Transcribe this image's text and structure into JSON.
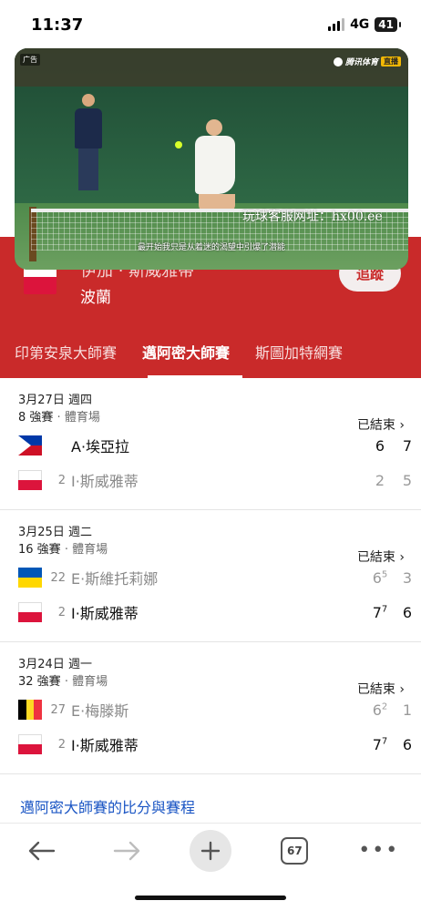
{
  "status_bar": {
    "time": "11:37",
    "network": "4G",
    "battery": "41"
  },
  "player_header": {
    "name": "伊加 · 斯威雅蒂",
    "country": "波蘭",
    "follow_label": "追蹤"
  },
  "video": {
    "ad_label": "广告",
    "brand": "腾讯体育",
    "live_label": "直播",
    "subtitle": "最开始我只是从着迷的渴望中引爆了潜能",
    "watermark": "玩球客服网址：hx00.ee"
  },
  "tabs": [
    {
      "label": "印第安泉大師賽",
      "active": false
    },
    {
      "label": "邁阿密大師賽",
      "active": true
    },
    {
      "label": "斯圖加特網賽",
      "active": false
    }
  ],
  "matches": [
    {
      "date": "3月27日 週四",
      "round": "8 強賽",
      "venue": "體育場",
      "status": "已結束",
      "players": [
        {
          "flag": "philippines",
          "seed": "",
          "name": "A·埃亞拉",
          "winner": true,
          "sets": [
            {
              "v": "6",
              "tb": ""
            },
            {
              "v": "7",
              "tb": ""
            }
          ]
        },
        {
          "flag": "poland",
          "seed": "2",
          "name": "I·斯威雅蒂",
          "winner": false,
          "sets": [
            {
              "v": "2",
              "tb": ""
            },
            {
              "v": "5",
              "tb": ""
            }
          ]
        }
      ]
    },
    {
      "date": "3月25日 週二",
      "round": "16 強賽",
      "venue": "體育場",
      "status": "已結束",
      "players": [
        {
          "flag": "ukraine",
          "seed": "22",
          "name": "E·斯維托莉娜",
          "winner": false,
          "sets": [
            {
              "v": "6",
              "tb": "5"
            },
            {
              "v": "3",
              "tb": ""
            }
          ]
        },
        {
          "flag": "poland",
          "seed": "2",
          "name": "I·斯威雅蒂",
          "winner": true,
          "sets": [
            {
              "v": "7",
              "tb": "7"
            },
            {
              "v": "6",
              "tb": ""
            }
          ]
        }
      ]
    },
    {
      "date": "3月24日 週一",
      "round": "32 強賽",
      "venue": "體育場",
      "status": "已結束",
      "players": [
        {
          "flag": "belgium",
          "seed": "27",
          "name": "E·梅滕斯",
          "winner": false,
          "sets": [
            {
              "v": "6",
              "tb": "2"
            },
            {
              "v": "1",
              "tb": ""
            }
          ]
        },
        {
          "flag": "poland",
          "seed": "2",
          "name": "I·斯威雅蒂",
          "winner": true,
          "sets": [
            {
              "v": "7",
              "tb": "7"
            },
            {
              "v": "6",
              "tb": ""
            }
          ]
        }
      ]
    }
  ],
  "more_link": "邁阿密大師賽的比分與賽程",
  "toolbar": {
    "back_icon": "back-arrow-icon",
    "forward_icon": "forward-arrow-icon",
    "new_tab_icon": "plus-icon",
    "tab_count": "67",
    "more_icon": "more-dots-icon"
  },
  "colors": {
    "accent_red": "#c92a2a",
    "link_blue": "#1a55c4"
  }
}
